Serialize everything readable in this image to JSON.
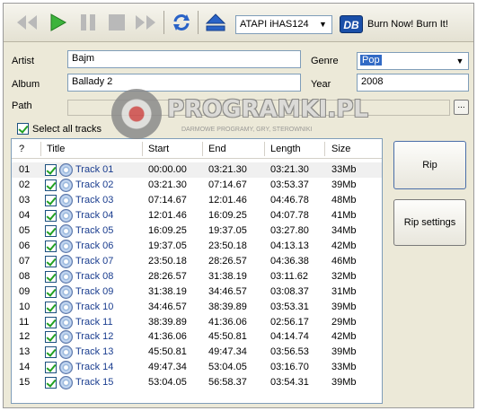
{
  "toolbar": {
    "buttons": [
      "rewind-icon",
      "play-icon",
      "pause-icon",
      "stop-icon",
      "fast-forward-icon",
      "refresh-icon",
      "eject-icon"
    ],
    "drive": "ATAPI iHAS124",
    "burn_label": "Burn Now! Burn It!",
    "burn_logo": "DB"
  },
  "form": {
    "artist_label": "Artist",
    "artist_value": "Bajm",
    "album_label": "Album",
    "album_value": "Ballady 2",
    "path_label": "Path",
    "path_value": "",
    "path_button": "...",
    "genre_label": "Genre",
    "genre_value": "Pop",
    "year_label": "Year",
    "year_value": "2008",
    "select_all_label": "Select all tracks"
  },
  "table": {
    "columns": [
      "?",
      "Title",
      "Start",
      "End",
      "Length",
      "Size"
    ],
    "rows": [
      {
        "n": "01",
        "title": "Track 01",
        "start": "00:00.00",
        "end": "03:21.30",
        "length": "03:21.30",
        "size": "33Mb"
      },
      {
        "n": "02",
        "title": "Track 02",
        "start": "03:21.30",
        "end": "07:14.67",
        "length": "03:53.37",
        "size": "39Mb"
      },
      {
        "n": "03",
        "title": "Track 03",
        "start": "07:14.67",
        "end": "12:01.46",
        "length": "04:46.78",
        "size": "48Mb"
      },
      {
        "n": "04",
        "title": "Track 04",
        "start": "12:01.46",
        "end": "16:09.25",
        "length": "04:07.78",
        "size": "41Mb"
      },
      {
        "n": "05",
        "title": "Track 05",
        "start": "16:09.25",
        "end": "19:37.05",
        "length": "03:27.80",
        "size": "34Mb"
      },
      {
        "n": "06",
        "title": "Track 06",
        "start": "19:37.05",
        "end": "23:50.18",
        "length": "04:13.13",
        "size": "42Mb"
      },
      {
        "n": "07",
        "title": "Track 07",
        "start": "23:50.18",
        "end": "28:26.57",
        "length": "04:36.38",
        "size": "46Mb"
      },
      {
        "n": "08",
        "title": "Track 08",
        "start": "28:26.57",
        "end": "31:38.19",
        "length": "03:11.62",
        "size": "32Mb"
      },
      {
        "n": "09",
        "title": "Track 09",
        "start": "31:38.19",
        "end": "34:46.57",
        "length": "03:08.37",
        "size": "31Mb"
      },
      {
        "n": "10",
        "title": "Track 10",
        "start": "34:46.57",
        "end": "38:39.89",
        "length": "03:53.31",
        "size": "39Mb"
      },
      {
        "n": "11",
        "title": "Track 11",
        "start": "38:39.89",
        "end": "41:36.06",
        "length": "02:56.17",
        "size": "29Mb"
      },
      {
        "n": "12",
        "title": "Track 12",
        "start": "41:36.06",
        "end": "45:50.81",
        "length": "04:14.74",
        "size": "42Mb"
      },
      {
        "n": "13",
        "title": "Track 13",
        "start": "45:50.81",
        "end": "49:47.34",
        "length": "03:56.53",
        "size": "39Mb"
      },
      {
        "n": "14",
        "title": "Track 14",
        "start": "49:47.34",
        "end": "53:04.05",
        "length": "03:16.70",
        "size": "33Mb"
      },
      {
        "n": "15",
        "title": "Track 15",
        "start": "53:04.05",
        "end": "56:58.37",
        "length": "03:54.31",
        "size": "39Mb"
      }
    ]
  },
  "actions": {
    "rip_label": "Rip",
    "rip_settings_label": "Rip settings"
  },
  "watermark": {
    "text": "PROGRAMKI.PL",
    "subtext": "DARMOWE PROGRAMY, GRY, STEROWNIKI"
  },
  "colors": {
    "window_bg": "#ece9d8",
    "accent_green": "#21a121",
    "accent_blue": "#1a4fa8",
    "selection": "#316ac5"
  }
}
